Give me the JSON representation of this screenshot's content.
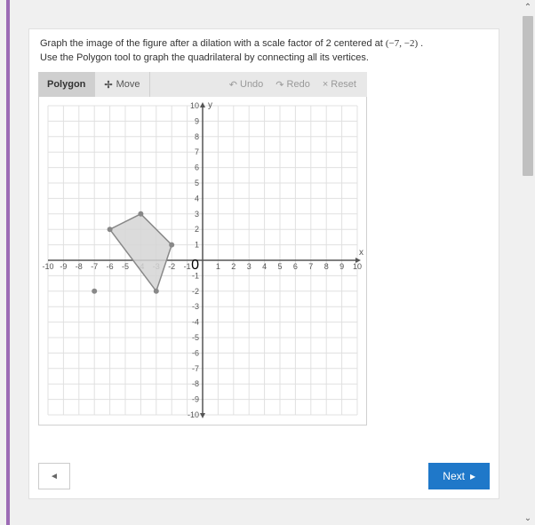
{
  "instructions": {
    "line1_pre": "Graph the image of the figure after a dilation with a scale factor of 2 centered at ",
    "center": "(−7,  −2)",
    "line1_post": " .",
    "line2": "Use the Polygon tool to graph the quadrilateral by connecting all its vertices."
  },
  "toolbar": {
    "polygon": "Polygon",
    "move": "Move",
    "undo": "Undo",
    "redo": "Redo",
    "reset": "Reset"
  },
  "chart_data": {
    "type": "scatter",
    "title": "",
    "xlabel": "x",
    "ylabel": "y",
    "xlim": [
      -10,
      10
    ],
    "ylim": [
      -10,
      10
    ],
    "xticks": [
      -10,
      -9,
      -8,
      -7,
      -6,
      -5,
      -4,
      -3,
      -2,
      -1,
      1,
      2,
      3,
      4,
      5,
      6,
      7,
      8,
      9,
      10
    ],
    "yticks": [
      -10,
      -9,
      -8,
      -7,
      -6,
      -5,
      -4,
      -3,
      -2,
      -1,
      1,
      2,
      3,
      4,
      5,
      6,
      7,
      8,
      9,
      10
    ],
    "grid": true,
    "series": [
      {
        "name": "quadrilateral",
        "kind": "polygon",
        "points": [
          [
            -6,
            2
          ],
          [
            -4,
            3
          ],
          [
            -2,
            1
          ],
          [
            -3,
            -2
          ]
        ]
      },
      {
        "name": "point",
        "kind": "point",
        "points": [
          [
            -7,
            -2
          ]
        ]
      }
    ]
  },
  "nav": {
    "next": "Next"
  }
}
